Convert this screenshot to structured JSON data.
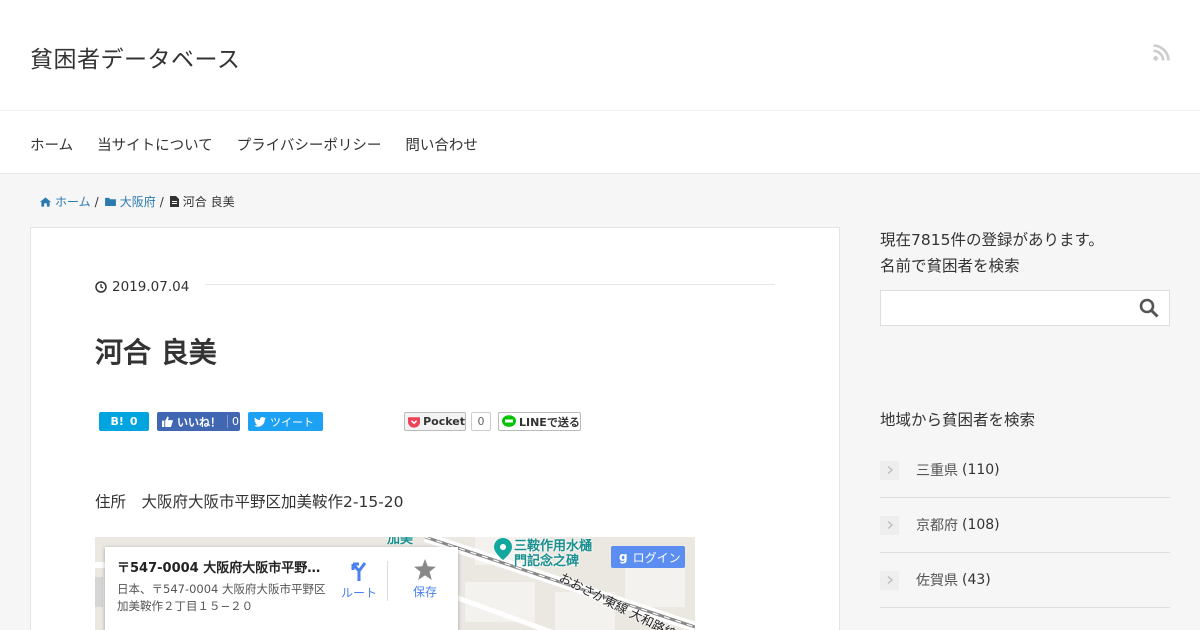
{
  "header": {
    "site_title": "貧困者データベース"
  },
  "nav": {
    "items": [
      "ホーム",
      "当サイトについて",
      "プライバシーポリシー",
      "問い合わせ"
    ]
  },
  "breadcrumb": {
    "home": "ホーム",
    "category": "大阪府",
    "current": "河合 良美"
  },
  "post": {
    "date": "2019.07.04",
    "title": "河合 良美",
    "address": "住所　大阪府大阪市平野区加美鞍作2-15-20"
  },
  "share": {
    "hatena_count": "0",
    "fb_label": "いいね！",
    "fb_count": "0",
    "tweet_label": "ツイート",
    "pocket_label": "Pocket",
    "pocket_count": "0",
    "line_label": "LINEで送る"
  },
  "map": {
    "card_title": "〒547-0004 大阪府大阪市平野...",
    "card_address": "日本、〒547-0004 大阪府大阪市平野区加美鞍作２丁目１５−２０",
    "route_label": "ルート",
    "save_label": "保存",
    "login_label": "ログイン",
    "poi_label_1": "三鞍作用水樋",
    "poi_label_2": "門記念之碑",
    "poi_top_label": "加美",
    "rail_label": "おおさか東線 大和路線"
  },
  "sidebar": {
    "count_text": "現在7815件の登録があります。",
    "search_title": "名前で貧困者を検索",
    "region_title": "地域から貧困者を検索",
    "prefectures": [
      {
        "name": "三重県",
        "count": "(110)"
      },
      {
        "name": "京都府",
        "count": "(108)"
      },
      {
        "name": "佐賀県",
        "count": "(43)"
      }
    ]
  },
  "colors": {
    "link": "#2a7ab0",
    "hatena": "#00a4de",
    "facebook": "#4267b2",
    "twitter": "#1da1f2",
    "map_button": "#5b8ef0"
  }
}
